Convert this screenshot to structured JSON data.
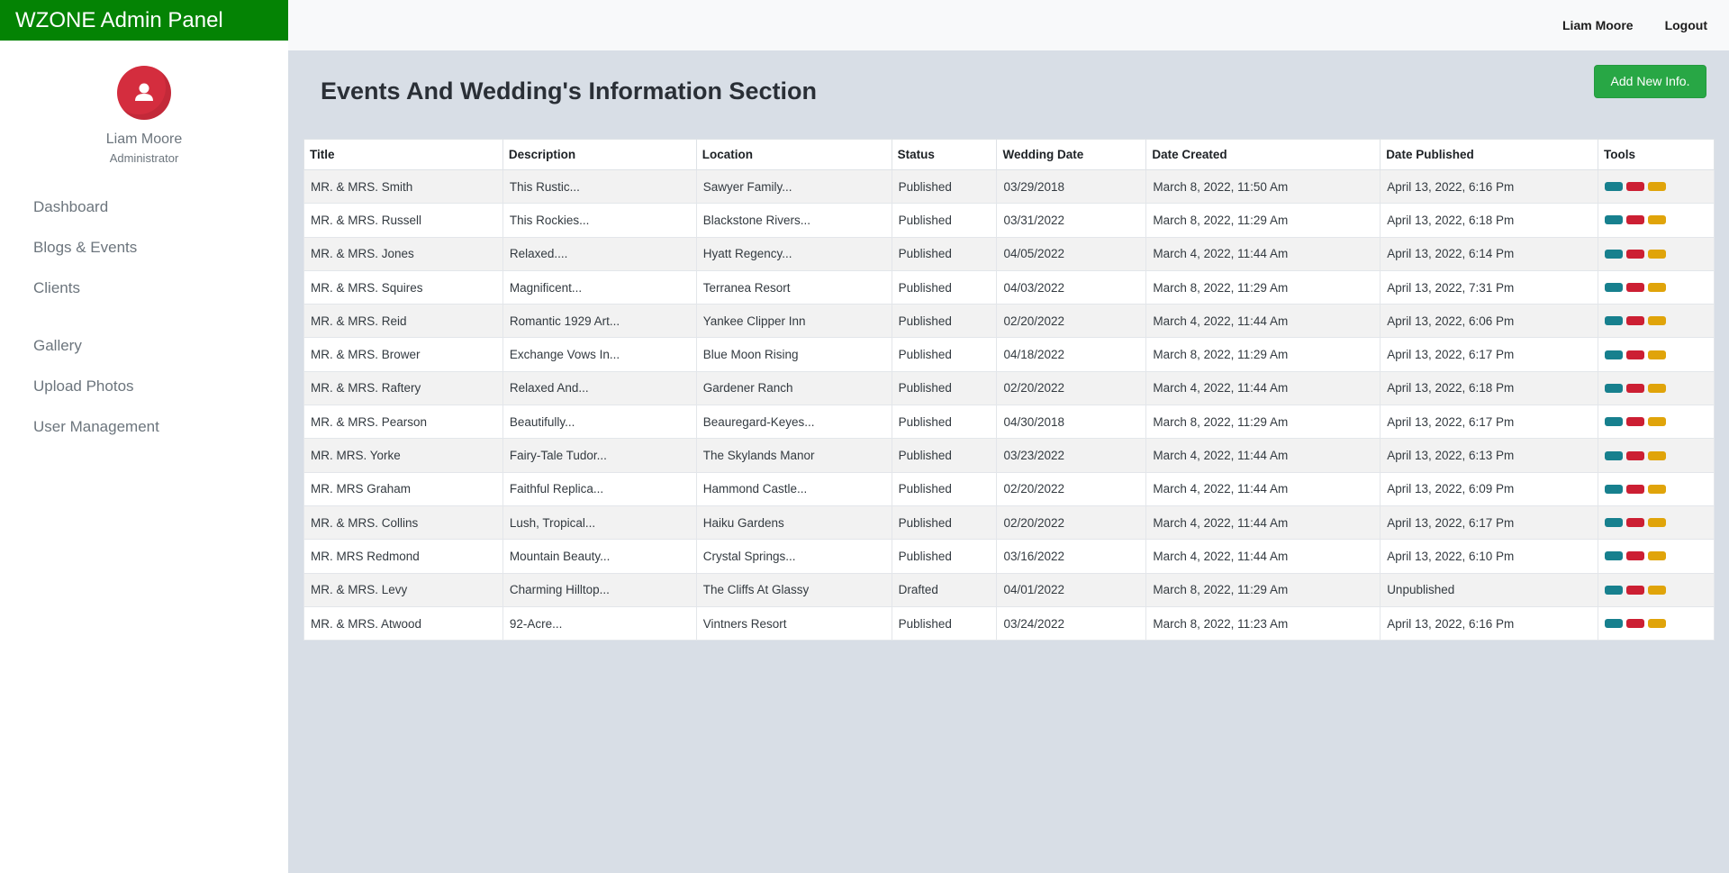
{
  "app": {
    "brand": "WZONE Admin Panel"
  },
  "user": {
    "name": "Liam Moore",
    "role": "Administrator"
  },
  "topbar": {
    "user_name": "Liam Moore",
    "logout": "Logout"
  },
  "sidebar": {
    "items": [
      {
        "label": "Dashboard"
      },
      {
        "label": "Blogs & Events"
      },
      {
        "label": "Clients"
      },
      {
        "label": "Gallery"
      },
      {
        "label": "Upload Photos"
      },
      {
        "label": "User Management"
      }
    ]
  },
  "main": {
    "title": "Events And Wedding's Information Section",
    "add_button": "Add New Info."
  },
  "table": {
    "headers": [
      "Title",
      "Description",
      "Location",
      "Status",
      "Wedding Date",
      "Date Created",
      "Date Published",
      "Tools"
    ],
    "rows": [
      [
        "MR. & MRS. Smith",
        "This Rustic...",
        "Sawyer Family...",
        "Published",
        "03/29/2018",
        "March 8, 2022, 11:50 Am",
        "April 13, 2022, 6:16 Pm"
      ],
      [
        "MR. & MRS. Russell",
        "This Rockies...",
        "Blackstone Rivers...",
        "Published",
        "03/31/2022",
        "March 8, 2022, 11:29 Am",
        "April 13, 2022, 6:18 Pm"
      ],
      [
        "MR. & MRS. Jones",
        "Relaxed....",
        "Hyatt Regency...",
        "Published",
        "04/05/2022",
        "March 4, 2022, 11:44 Am",
        "April 13, 2022, 6:14 Pm"
      ],
      [
        "MR. & MRS. Squires",
        "Magnificent...",
        "Terranea Resort",
        "Published",
        "04/03/2022",
        "March 8, 2022, 11:29 Am",
        "April 13, 2022, 7:31 Pm"
      ],
      [
        "MR. & MRS. Reid",
        "Romantic 1929 Art...",
        "Yankee Clipper Inn",
        "Published",
        "02/20/2022",
        "March 4, 2022, 11:44 Am",
        "April 13, 2022, 6:06 Pm"
      ],
      [
        "MR. & MRS. Brower",
        "Exchange Vows In...",
        "Blue Moon Rising",
        "Published",
        "04/18/2022",
        "March 8, 2022, 11:29 Am",
        "April 13, 2022, 6:17 Pm"
      ],
      [
        "MR. & MRS. Raftery",
        "Relaxed And...",
        "Gardener Ranch",
        "Published",
        "02/20/2022",
        "March 4, 2022, 11:44 Am",
        "April 13, 2022, 6:18 Pm"
      ],
      [
        "MR. & MRS. Pearson",
        "Beautifully...",
        "Beauregard-Keyes...",
        "Published",
        "04/30/2018",
        "March 8, 2022, 11:29 Am",
        "April 13, 2022, 6:17 Pm"
      ],
      [
        "MR. MRS. Yorke",
        "Fairy-Tale Tudor...",
        "The Skylands Manor",
        "Published",
        "03/23/2022",
        "March 4, 2022, 11:44 Am",
        "April 13, 2022, 6:13 Pm"
      ],
      [
        "MR. MRS Graham",
        "Faithful Replica...",
        "Hammond Castle...",
        "Published",
        "02/20/2022",
        "March 4, 2022, 11:44 Am",
        "April 13, 2022, 6:09 Pm"
      ],
      [
        "MR. & MRS. Collins",
        "Lush, Tropical...",
        "Haiku Gardens",
        "Published",
        "02/20/2022",
        "March 4, 2022, 11:44 Am",
        "April 13, 2022, 6:17 Pm"
      ],
      [
        "MR. MRS Redmond",
        "Mountain Beauty...",
        "Crystal Springs...",
        "Published",
        "03/16/2022",
        "March 4, 2022, 11:44 Am",
        "April 13, 2022, 6:10 Pm"
      ],
      [
        "MR. & MRS. Levy",
        "Charming Hilltop...",
        "The Cliffs At Glassy",
        "Drafted",
        "04/01/2022",
        "March 8, 2022, 11:29 Am",
        "Unpublished"
      ],
      [
        "MR. & MRS. Atwood",
        "92-Acre...",
        "Vintners Resort",
        "Published",
        "03/24/2022",
        "March 8, 2022, 11:23 Am",
        "April 13, 2022, 6:16 Pm"
      ]
    ]
  },
  "tools": {
    "icons": [
      "view-icon",
      "delete-icon",
      "edit-icon"
    ]
  },
  "colors": {
    "brand": "#048304",
    "add_button": "#28a745",
    "avatar": "#d42d3e",
    "tool_view": "#17808e",
    "tool_delete": "#cc1f33",
    "tool_edit": "#e0a40a",
    "main_bg": "#d8dee6"
  }
}
